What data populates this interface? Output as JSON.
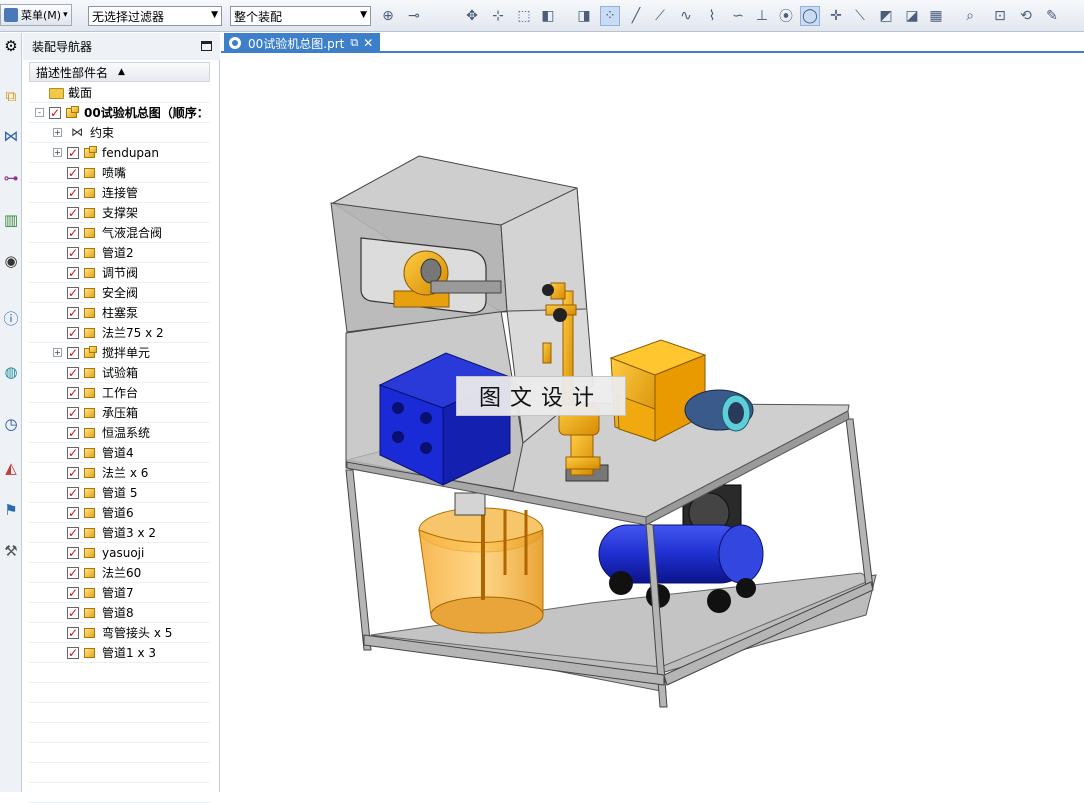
{
  "toolbar": {
    "menu_label": "菜单(M)",
    "filter_value": "无选择过滤器",
    "scope_value": "整个装配",
    "icons": [
      "assembly-icon",
      "constraint-icon",
      "move-icon",
      "snap-icon",
      "select-box-icon",
      "view-cube-icon",
      "shaded-cube-icon",
      "snap-points-icon",
      "line-icon",
      "line-angle-icon",
      "curve-icon",
      "spline-icon",
      "wave-icon",
      "perpendicular-icon",
      "point-icon",
      "circle-center-icon",
      "cross-icon",
      "tangent-icon",
      "surface-icon",
      "face-icon",
      "grid-icon",
      "zoom-icon",
      "fit-icon",
      "rotate-icon",
      "pan-icon"
    ]
  },
  "navigator": {
    "title": "装配导航器",
    "column_header": "描述性部件名",
    "items": [
      {
        "label": "截面",
        "type": "folder",
        "level": 0,
        "expand": "",
        "checked": false
      },
      {
        "label": "00试验机总图（顺序：",
        "type": "assembly",
        "level": 0,
        "expand": "-",
        "checked": true,
        "bold": true
      },
      {
        "label": "约束",
        "type": "constraint",
        "level": 1,
        "expand": "+",
        "checked": false
      },
      {
        "label": "fendupan",
        "type": "assembly",
        "level": 1,
        "expand": "+",
        "checked": true
      },
      {
        "label": "喷嘴",
        "type": "part",
        "level": 1,
        "expand": "",
        "checked": true
      },
      {
        "label": "连接管",
        "type": "part",
        "level": 1,
        "expand": "",
        "checked": true
      },
      {
        "label": "支撑架",
        "type": "part",
        "level": 1,
        "expand": "",
        "checked": true
      },
      {
        "label": "气液混合阀",
        "type": "part",
        "level": 1,
        "expand": "",
        "checked": true
      },
      {
        "label": "管道2",
        "type": "part",
        "level": 1,
        "expand": "",
        "checked": true
      },
      {
        "label": "调节阀",
        "type": "part",
        "level": 1,
        "expand": "",
        "checked": true
      },
      {
        "label": "安全阀",
        "type": "part",
        "level": 1,
        "expand": "",
        "checked": true
      },
      {
        "label": "柱塞泵",
        "type": "part",
        "level": 1,
        "expand": "",
        "checked": true
      },
      {
        "label": "法兰75 x 2",
        "type": "part",
        "level": 1,
        "expand": "",
        "checked": true
      },
      {
        "label": "搅拌单元",
        "type": "assembly",
        "level": 1,
        "expand": "+",
        "checked": true
      },
      {
        "label": "试验箱",
        "type": "part",
        "level": 1,
        "expand": "",
        "checked": true
      },
      {
        "label": "工作台",
        "type": "part",
        "level": 1,
        "expand": "",
        "checked": true
      },
      {
        "label": "承压箱",
        "type": "part",
        "level": 1,
        "expand": "",
        "checked": true
      },
      {
        "label": "恒温系统",
        "type": "part",
        "level": 1,
        "expand": "",
        "checked": true
      },
      {
        "label": "管道4",
        "type": "part",
        "level": 1,
        "expand": "",
        "checked": true
      },
      {
        "label": "法兰 x 6",
        "type": "part",
        "level": 1,
        "expand": "",
        "checked": true
      },
      {
        "label": "管道 5",
        "type": "part",
        "level": 1,
        "expand": "",
        "checked": true
      },
      {
        "label": "管道6",
        "type": "part",
        "level": 1,
        "expand": "",
        "checked": true
      },
      {
        "label": "管道3 x 2",
        "type": "part",
        "level": 1,
        "expand": "",
        "checked": true
      },
      {
        "label": "yasuoji",
        "type": "part",
        "level": 1,
        "expand": "",
        "checked": true
      },
      {
        "label": "法兰60",
        "type": "part",
        "level": 1,
        "expand": "",
        "checked": true
      },
      {
        "label": "管道7",
        "type": "part",
        "level": 1,
        "expand": "",
        "checked": true
      },
      {
        "label": "管道8",
        "type": "part",
        "level": 1,
        "expand": "",
        "checked": true
      },
      {
        "label": "弯管接头 x 5",
        "type": "part",
        "level": 1,
        "expand": "",
        "checked": true
      },
      {
        "label": "管道1 x 3",
        "type": "part",
        "level": 1,
        "expand": "",
        "checked": true
      }
    ]
  },
  "document": {
    "tab_label": "00试验机总图.prt"
  },
  "viewport": {
    "watermark": "图文设计"
  },
  "colors": {
    "accent": "#3d7fc8",
    "check": "#d01010",
    "part_yellow": "#e6a818",
    "tank_blue": "#1e2fd0",
    "frame_gray": "#b8b8b8"
  }
}
